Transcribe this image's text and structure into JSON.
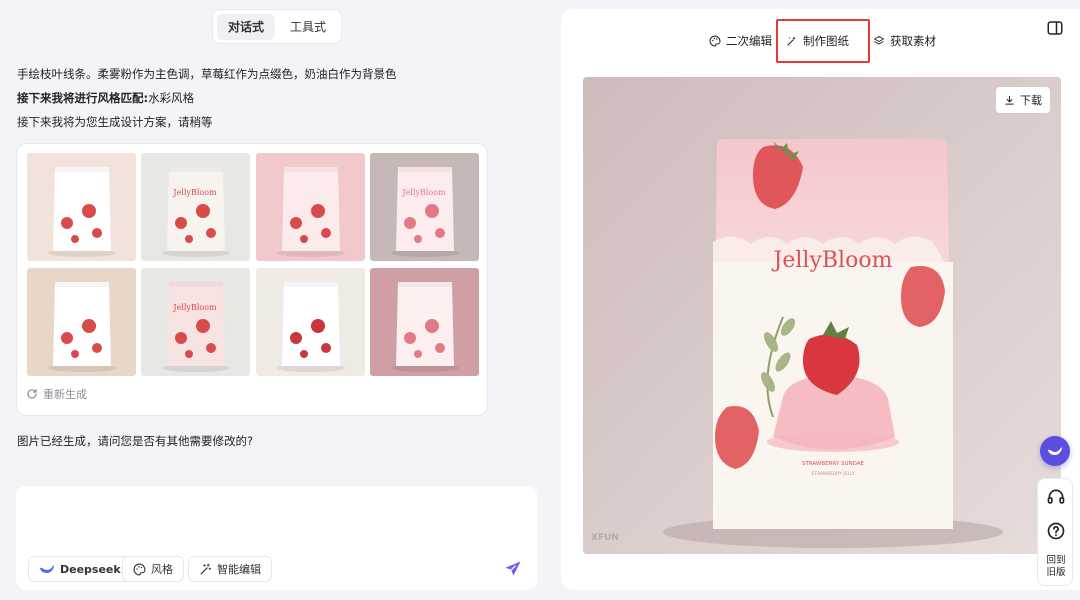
{
  "mode_switch": {
    "tabs": [
      "对话式",
      "工具式"
    ],
    "active_index": 0
  },
  "chat": {
    "line1": "手绘枝叶线条。柔雾粉作为主色调，草莓红作为点缀色，奶油白作为背景色",
    "line2_bold": "接下来我将进行风格匹配:",
    "line2_rest": "水彩风格",
    "line3": "接下来我将为您生成设计方案，请稍等",
    "regenerate_label": "重新生成",
    "after_message": "图片已经生成，请问您是否有其他需要修改的?"
  },
  "gallery": {
    "thumbnails": [
      {
        "bg": "#f1e3da",
        "bag": "#ffffff",
        "accent": "#d94b4b",
        "label": ""
      },
      {
        "bg": "#e7e7e4",
        "bag": "#f7f3ee",
        "accent": "#d94b4b",
        "label": "JellyBloom"
      },
      {
        "bg": "#f2c9ca",
        "bag": "#fbeceb",
        "accent": "#d94b4b",
        "label": ""
      },
      {
        "bg": "#c5b8b7",
        "bag": "#fcecef",
        "accent": "#e27a86",
        "label": "JellyBloom"
      },
      {
        "bg": "#e8d6c6",
        "bag": "#ffffff",
        "accent": "#d94b4b",
        "label": ""
      },
      {
        "bg": "#e7e7e4",
        "bag": "#f7e4e2",
        "accent": "#d94b4b",
        "label": "JellyBloom"
      },
      {
        "bg": "#efeae4",
        "bag": "#ffffff",
        "accent": "#c9363b",
        "label": ""
      },
      {
        "bg": "#cf9fa3",
        "bag": "#fbeff0",
        "accent": "#e27a86",
        "label": ""
      }
    ]
  },
  "composer": {
    "chips": [
      {
        "label": "Deepseek",
        "icon": "whale-icon"
      },
      {
        "label": "风格",
        "icon": "palette-icon"
      },
      {
        "label": "智能编辑",
        "icon": "magic-wand-icon"
      }
    ],
    "send_color": "#6d5ff0"
  },
  "panel": {
    "tabs": [
      {
        "label": "二次编辑",
        "icon": "palette-icon"
      },
      {
        "label": "制作图纸",
        "icon": "sparkle-icon",
        "highlighted": true
      },
      {
        "label": "获取素材",
        "icon": "layers-icon"
      }
    ],
    "download_label": "下载",
    "watermark": "XFUN",
    "product": {
      "brand": "JellyBloom",
      "subtitle": "STRAWBERRY SUNDAE",
      "subtitle2": "STRAWBERRY JELLY"
    }
  },
  "float_tools": {
    "back_label_1": "回到",
    "back_label_2": "旧版"
  },
  "colors": {
    "accent": "#6d5ff0",
    "highlight_border": "#e53935",
    "strawberry": "#d94b4b",
    "preview_bg": "#c9b9b9"
  }
}
